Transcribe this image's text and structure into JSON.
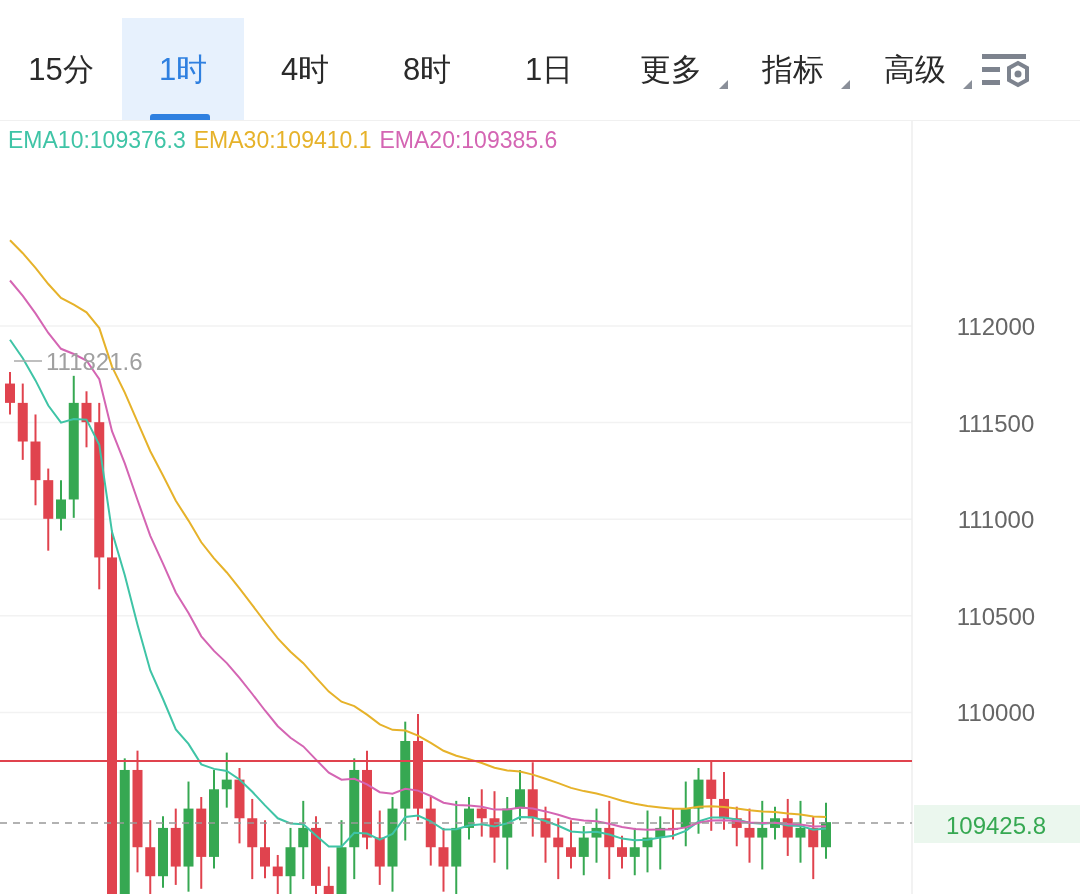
{
  "tabs": [
    {
      "label": "15分",
      "kind": "period",
      "selected": false
    },
    {
      "label": "1时",
      "kind": "period",
      "selected": true
    },
    {
      "label": "4时",
      "kind": "period",
      "selected": false
    },
    {
      "label": "8时",
      "kind": "period",
      "selected": false
    },
    {
      "label": "1日",
      "kind": "period",
      "selected": false
    },
    {
      "label": "更多",
      "kind": "dropdown",
      "selected": false
    },
    {
      "label": "指标",
      "kind": "dropdown",
      "selected": false
    },
    {
      "label": "高级",
      "kind": "dropdown",
      "selected": false
    }
  ],
  "legend": [
    {
      "label": "EMA10:109376.3",
      "color": "#3fc4a6"
    },
    {
      "label": "EMA30:109410.1",
      "color": "#e6b22a"
    },
    {
      "label": "EMA20:109385.6",
      "color": "#d465b3"
    }
  ],
  "chart": {
    "price_axis": [
      "112000",
      "111500",
      "111000",
      "110500",
      "110000"
    ],
    "high_label": "111821.6",
    "last_price": "109425.8"
  }
}
